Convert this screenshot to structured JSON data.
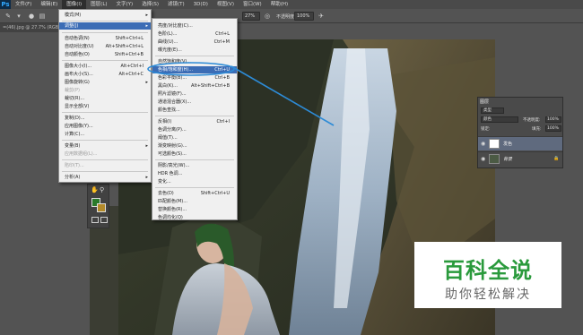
{
  "menubar": {
    "logo": "Ps",
    "items": [
      "文件(F)",
      "编辑(E)",
      "图像(I)",
      "图层(L)",
      "文字(Y)",
      "选择(S)",
      "滤镜(T)",
      "3D(D)",
      "视图(V)",
      "窗口(W)",
      "帮助(H)"
    ]
  },
  "options": {
    "zoom": "27%",
    "opacity_label": "不透明度:",
    "opacity_value": "100%"
  },
  "doc_tab": "=(46).jpg @ 27.7% (RGB",
  "image_menu": {
    "items": [
      {
        "label": "模式(M)",
        "shortcut": "",
        "arrow": true,
        "disabled": false,
        "selected": false
      },
      {
        "label": "调整(J)",
        "shortcut": "",
        "arrow": true,
        "disabled": false,
        "selected": true
      },
      {
        "label": "自动色调(N)",
        "shortcut": "Shift+Ctrl+L",
        "arrow": false,
        "disabled": false,
        "selected": false
      },
      {
        "label": "自动对比度(U)",
        "shortcut": "Alt+Shift+Ctrl+L",
        "arrow": false,
        "disabled": false,
        "selected": false
      },
      {
        "label": "自动颜色(O)",
        "shortcut": "Shift+Ctrl+B",
        "arrow": false,
        "disabled": false,
        "selected": false
      },
      {
        "label": "图像大小(I)...",
        "shortcut": "Alt+Ctrl+I",
        "arrow": false,
        "disabled": false,
        "selected": false
      },
      {
        "label": "画布大小(S)...",
        "shortcut": "Alt+Ctrl+C",
        "arrow": false,
        "disabled": false,
        "selected": false
      },
      {
        "label": "图像旋转(G)",
        "shortcut": "",
        "arrow": true,
        "disabled": false,
        "selected": false
      },
      {
        "label": "裁剪(P)",
        "shortcut": "",
        "arrow": false,
        "disabled": true,
        "selected": false
      },
      {
        "label": "裁切(R)...",
        "shortcut": "",
        "arrow": false,
        "disabled": false,
        "selected": false
      },
      {
        "label": "显示全部(V)",
        "shortcut": "",
        "arrow": false,
        "disabled": false,
        "selected": false
      },
      {
        "label": "复制(D)...",
        "shortcut": "",
        "arrow": false,
        "disabled": false,
        "selected": false
      },
      {
        "label": "应用图像(Y)...",
        "shortcut": "",
        "arrow": false,
        "disabled": false,
        "selected": false
      },
      {
        "label": "计算(C)...",
        "shortcut": "",
        "arrow": false,
        "disabled": false,
        "selected": false
      },
      {
        "label": "变量(B)",
        "shortcut": "",
        "arrow": true,
        "disabled": false,
        "selected": false
      },
      {
        "label": "应用数据组(L)...",
        "shortcut": "",
        "arrow": false,
        "disabled": true,
        "selected": false
      },
      {
        "label": "陷印(T)...",
        "shortcut": "",
        "arrow": false,
        "disabled": true,
        "selected": false
      },
      {
        "label": "分析(A)",
        "shortcut": "",
        "arrow": true,
        "disabled": false,
        "selected": false
      }
    ]
  },
  "adjust_menu": {
    "items": [
      {
        "label": "亮度/对比度(C)...",
        "shortcut": "",
        "selected": false
      },
      {
        "label": "色阶(L)...",
        "shortcut": "Ctrl+L",
        "selected": false
      },
      {
        "label": "曲线(U)...",
        "shortcut": "Ctrl+M",
        "selected": false
      },
      {
        "label": "曝光度(E)...",
        "shortcut": "",
        "selected": false
      },
      {
        "label": "自然饱和度(V)...",
        "shortcut": "",
        "selected": false
      },
      {
        "label": "色相/饱和度(H)...",
        "shortcut": "Ctrl+U",
        "selected": true
      },
      {
        "label": "色彩平衡(B)...",
        "shortcut": "Ctrl+B",
        "selected": false
      },
      {
        "label": "黑白(K)...",
        "shortcut": "Alt+Shift+Ctrl+B",
        "selected": false
      },
      {
        "label": "照片滤镜(F)...",
        "shortcut": "",
        "selected": false
      },
      {
        "label": "通道混合器(X)...",
        "shortcut": "",
        "selected": false
      },
      {
        "label": "颜色查找...",
        "shortcut": "",
        "selected": false
      },
      {
        "label": "反相(I)",
        "shortcut": "Ctrl+I",
        "selected": false
      },
      {
        "label": "色调分离(P)...",
        "shortcut": "",
        "selected": false
      },
      {
        "label": "阈值(T)...",
        "shortcut": "",
        "selected": false
      },
      {
        "label": "渐变映射(G)...",
        "shortcut": "",
        "selected": false
      },
      {
        "label": "可选颜色(S)...",
        "shortcut": "",
        "selected": false
      },
      {
        "label": "阴影/高光(W)...",
        "shortcut": "",
        "selected": false
      },
      {
        "label": "HDR 色调...",
        "shortcut": "",
        "selected": false
      },
      {
        "label": "变化...",
        "shortcut": "",
        "selected": false
      },
      {
        "label": "去色(D)",
        "shortcut": "Shift+Ctrl+U",
        "selected": false
      },
      {
        "label": "匹配颜色(M)...",
        "shortcut": "",
        "selected": false
      },
      {
        "label": "替换颜色(R)...",
        "shortcut": "",
        "selected": false
      },
      {
        "label": "色调均化(Q)",
        "shortcut": "",
        "selected": false
      }
    ]
  },
  "layers_panel": {
    "tab": "图层",
    "kind_label": "类型",
    "blend_mode": "颜色",
    "opacity_label": "不透明度:",
    "opacity_value": "100%",
    "lock_label": "锁定:",
    "fill_label": "填充:",
    "fill_value": "100%",
    "layers": [
      "发色",
      "背景"
    ]
  },
  "watermark": {
    "line1": "百科全说",
    "line2": "助你轻松解决"
  },
  "colors": {
    "menu_highlight": "#3b6cb5",
    "watermark_green": "#2a9a3c",
    "callout_blue": "#2d8bd6"
  }
}
